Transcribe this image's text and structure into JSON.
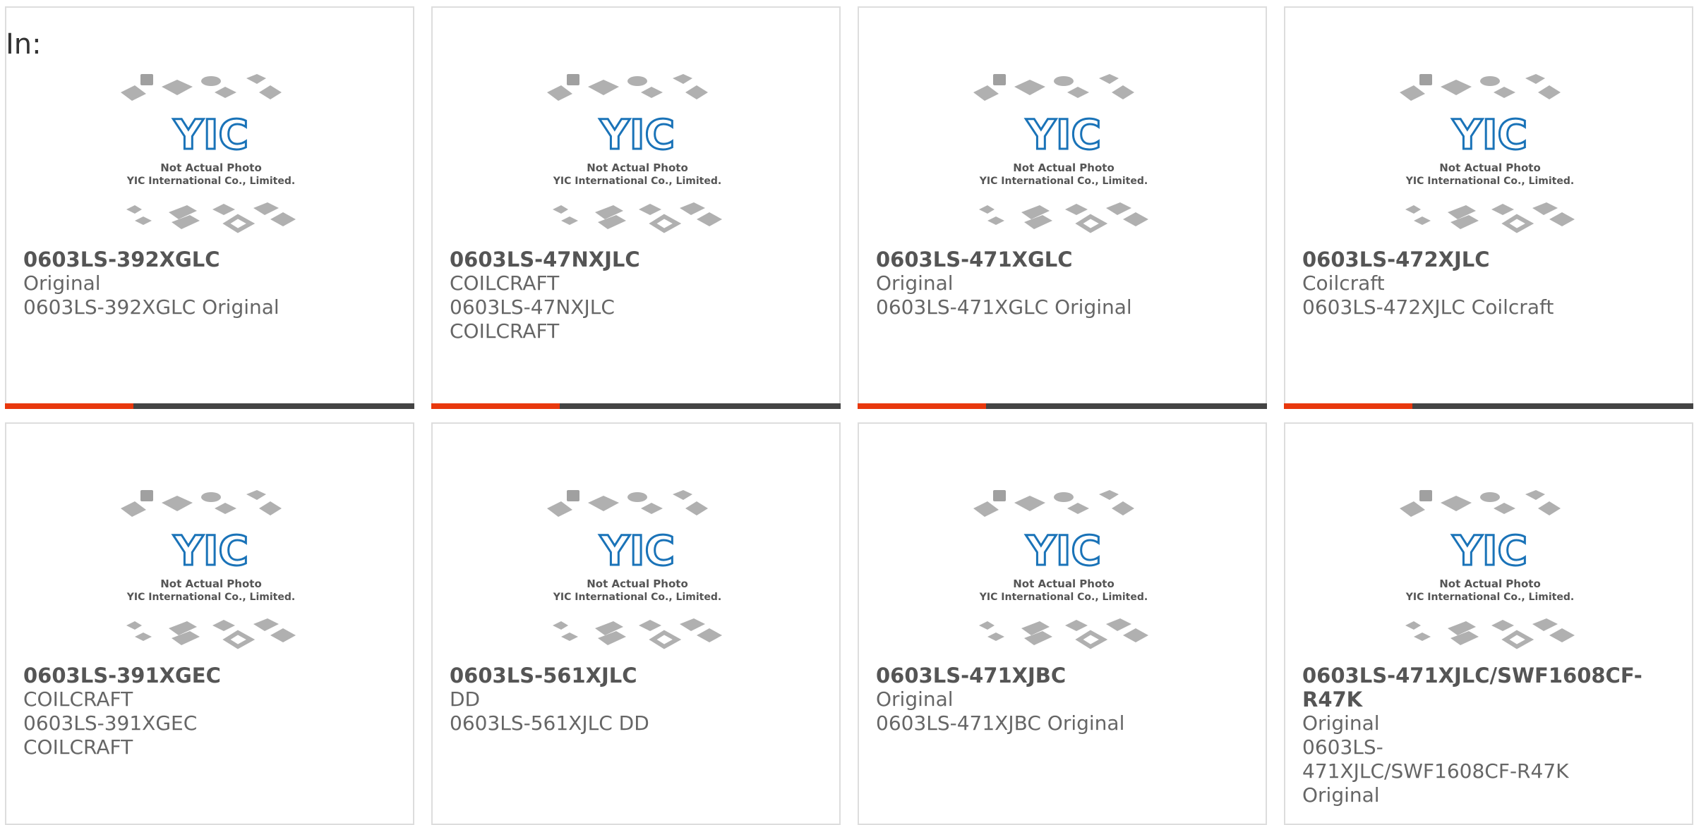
{
  "header": {
    "label": "In:"
  },
  "placeholder": {
    "line1": "Not Actual Photo",
    "line2": "YIC International Co., Limited.",
    "logo_text": "YIC"
  },
  "colors": {
    "accent": "#e8380d",
    "bar": "#444444",
    "logo": "#1a73b8",
    "chip": "#b0b0b0"
  },
  "products": [
    {
      "pn": "0603LS-392XGLC",
      "mfr": "Original",
      "desc": "0603LS-392XGLC Original"
    },
    {
      "pn": "0603LS-47NXJLC",
      "mfr": "COILCRAFT",
      "desc": "0603LS-47NXJLC COILCRAFT"
    },
    {
      "pn": "0603LS-471XGLC",
      "mfr": "Original",
      "desc": "0603LS-471XGLC Original"
    },
    {
      "pn": "0603LS-472XJLC",
      "mfr": "Coilcraft",
      "desc": "0603LS-472XJLC Coilcraft"
    },
    {
      "pn": "0603LS-391XGEC",
      "mfr": "COILCRAFT",
      "desc": "0603LS-391XGEC COILCRAFT"
    },
    {
      "pn": "0603LS-561XJLC",
      "mfr": "DD",
      "desc": "0603LS-561XJLC DD"
    },
    {
      "pn": "0603LS-471XJBC",
      "mfr": "Original",
      "desc": "0603LS-471XJBC Original"
    },
    {
      "pn": "0603LS-471XJLC/SWF1608CF-R47K",
      "mfr": "Original",
      "desc": "0603LS-471XJLC/SWF1608CF-R47K Original"
    }
  ]
}
